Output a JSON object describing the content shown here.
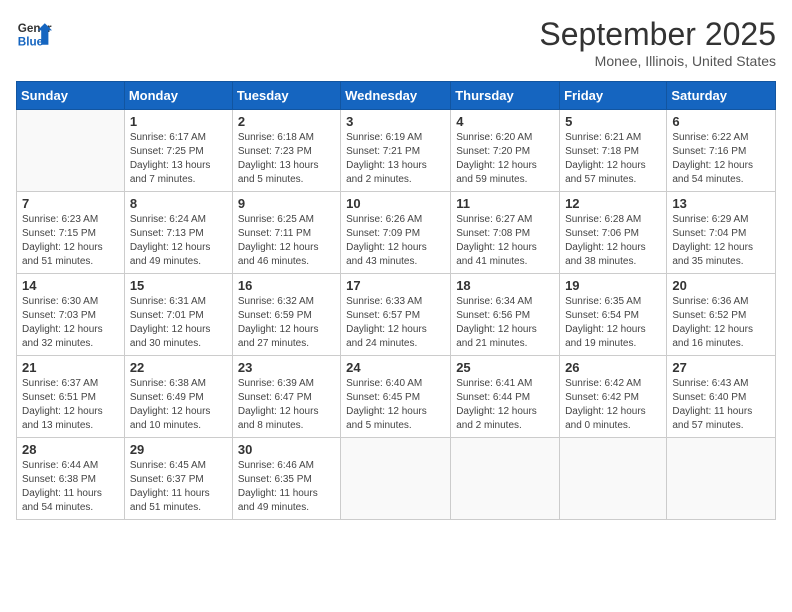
{
  "header": {
    "logo_line1": "General",
    "logo_line2": "Blue",
    "month": "September 2025",
    "location": "Monee, Illinois, United States"
  },
  "days_of_week": [
    "Sunday",
    "Monday",
    "Tuesday",
    "Wednesday",
    "Thursday",
    "Friday",
    "Saturday"
  ],
  "weeks": [
    [
      {
        "day": "",
        "info": ""
      },
      {
        "day": "1",
        "info": "Sunrise: 6:17 AM\nSunset: 7:25 PM\nDaylight: 13 hours\nand 7 minutes."
      },
      {
        "day": "2",
        "info": "Sunrise: 6:18 AM\nSunset: 7:23 PM\nDaylight: 13 hours\nand 5 minutes."
      },
      {
        "day": "3",
        "info": "Sunrise: 6:19 AM\nSunset: 7:21 PM\nDaylight: 13 hours\nand 2 minutes."
      },
      {
        "day": "4",
        "info": "Sunrise: 6:20 AM\nSunset: 7:20 PM\nDaylight: 12 hours\nand 59 minutes."
      },
      {
        "day": "5",
        "info": "Sunrise: 6:21 AM\nSunset: 7:18 PM\nDaylight: 12 hours\nand 57 minutes."
      },
      {
        "day": "6",
        "info": "Sunrise: 6:22 AM\nSunset: 7:16 PM\nDaylight: 12 hours\nand 54 minutes."
      }
    ],
    [
      {
        "day": "7",
        "info": "Sunrise: 6:23 AM\nSunset: 7:15 PM\nDaylight: 12 hours\nand 51 minutes."
      },
      {
        "day": "8",
        "info": "Sunrise: 6:24 AM\nSunset: 7:13 PM\nDaylight: 12 hours\nand 49 minutes."
      },
      {
        "day": "9",
        "info": "Sunrise: 6:25 AM\nSunset: 7:11 PM\nDaylight: 12 hours\nand 46 minutes."
      },
      {
        "day": "10",
        "info": "Sunrise: 6:26 AM\nSunset: 7:09 PM\nDaylight: 12 hours\nand 43 minutes."
      },
      {
        "day": "11",
        "info": "Sunrise: 6:27 AM\nSunset: 7:08 PM\nDaylight: 12 hours\nand 41 minutes."
      },
      {
        "day": "12",
        "info": "Sunrise: 6:28 AM\nSunset: 7:06 PM\nDaylight: 12 hours\nand 38 minutes."
      },
      {
        "day": "13",
        "info": "Sunrise: 6:29 AM\nSunset: 7:04 PM\nDaylight: 12 hours\nand 35 minutes."
      }
    ],
    [
      {
        "day": "14",
        "info": "Sunrise: 6:30 AM\nSunset: 7:03 PM\nDaylight: 12 hours\nand 32 minutes."
      },
      {
        "day": "15",
        "info": "Sunrise: 6:31 AM\nSunset: 7:01 PM\nDaylight: 12 hours\nand 30 minutes."
      },
      {
        "day": "16",
        "info": "Sunrise: 6:32 AM\nSunset: 6:59 PM\nDaylight: 12 hours\nand 27 minutes."
      },
      {
        "day": "17",
        "info": "Sunrise: 6:33 AM\nSunset: 6:57 PM\nDaylight: 12 hours\nand 24 minutes."
      },
      {
        "day": "18",
        "info": "Sunrise: 6:34 AM\nSunset: 6:56 PM\nDaylight: 12 hours\nand 21 minutes."
      },
      {
        "day": "19",
        "info": "Sunrise: 6:35 AM\nSunset: 6:54 PM\nDaylight: 12 hours\nand 19 minutes."
      },
      {
        "day": "20",
        "info": "Sunrise: 6:36 AM\nSunset: 6:52 PM\nDaylight: 12 hours\nand 16 minutes."
      }
    ],
    [
      {
        "day": "21",
        "info": "Sunrise: 6:37 AM\nSunset: 6:51 PM\nDaylight: 12 hours\nand 13 minutes."
      },
      {
        "day": "22",
        "info": "Sunrise: 6:38 AM\nSunset: 6:49 PM\nDaylight: 12 hours\nand 10 minutes."
      },
      {
        "day": "23",
        "info": "Sunrise: 6:39 AM\nSunset: 6:47 PM\nDaylight: 12 hours\nand 8 minutes."
      },
      {
        "day": "24",
        "info": "Sunrise: 6:40 AM\nSunset: 6:45 PM\nDaylight: 12 hours\nand 5 minutes."
      },
      {
        "day": "25",
        "info": "Sunrise: 6:41 AM\nSunset: 6:44 PM\nDaylight: 12 hours\nand 2 minutes."
      },
      {
        "day": "26",
        "info": "Sunrise: 6:42 AM\nSunset: 6:42 PM\nDaylight: 12 hours\nand 0 minutes."
      },
      {
        "day": "27",
        "info": "Sunrise: 6:43 AM\nSunset: 6:40 PM\nDaylight: 11 hours\nand 57 minutes."
      }
    ],
    [
      {
        "day": "28",
        "info": "Sunrise: 6:44 AM\nSunset: 6:38 PM\nDaylight: 11 hours\nand 54 minutes."
      },
      {
        "day": "29",
        "info": "Sunrise: 6:45 AM\nSunset: 6:37 PM\nDaylight: 11 hours\nand 51 minutes."
      },
      {
        "day": "30",
        "info": "Sunrise: 6:46 AM\nSunset: 6:35 PM\nDaylight: 11 hours\nand 49 minutes."
      },
      {
        "day": "",
        "info": ""
      },
      {
        "day": "",
        "info": ""
      },
      {
        "day": "",
        "info": ""
      },
      {
        "day": "",
        "info": ""
      }
    ]
  ]
}
